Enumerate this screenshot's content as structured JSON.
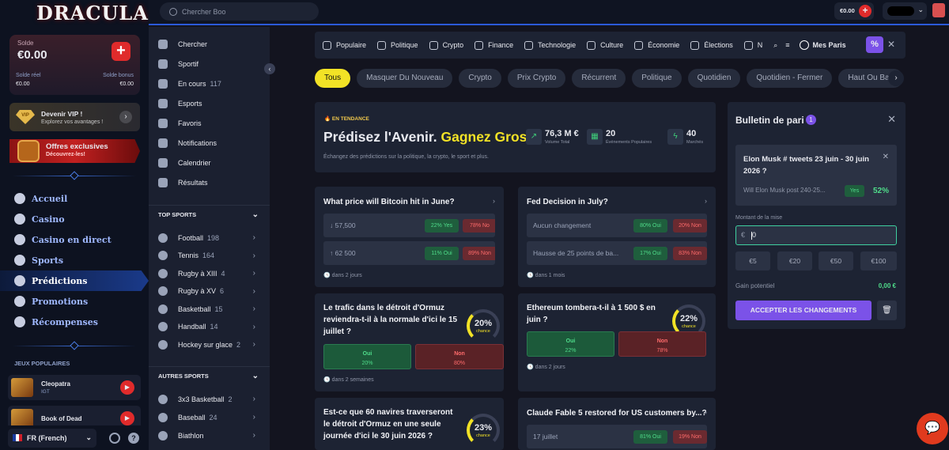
{
  "logo": "DRACULA",
  "wallet": {
    "label": "Solde",
    "amount": "€0.00",
    "real_label": "Solde réel",
    "real_value": "€0.00",
    "bonus_label": "Solde bonus",
    "bonus_value": "€0.00"
  },
  "vip": {
    "title": "Devenir VIP !",
    "subtitle": "Explorez vos avantages !",
    "gem": "VIP"
  },
  "offers": {
    "title": "Offres exclusives",
    "subtitle": "Découvrez-les!"
  },
  "menu": [
    {
      "label": "Accueil"
    },
    {
      "label": "Casino"
    },
    {
      "label": "Casino en direct"
    },
    {
      "label": "Sports"
    },
    {
      "label": "Prédictions"
    },
    {
      "label": "Promotions"
    },
    {
      "label": "Récompenses"
    }
  ],
  "popular_title": "JEUX POPULAIRES",
  "games": [
    {
      "name": "Cleopatra",
      "sub": "IGT"
    },
    {
      "name": "Book of Dead",
      "sub": ""
    }
  ],
  "language": "FR (French)",
  "search_placeholder": "Chercher Boo",
  "balance": "€0.00",
  "nav": {
    "items": [
      {
        "label": "Chercher",
        "count": ""
      },
      {
        "label": "Sportif",
        "count": ""
      },
      {
        "label": "En cours",
        "count": "117"
      },
      {
        "label": "Esports",
        "count": ""
      },
      {
        "label": "Favoris",
        "count": ""
      },
      {
        "label": "Notifications",
        "count": ""
      },
      {
        "label": "Calendrier",
        "count": ""
      },
      {
        "label": "Résultats",
        "count": ""
      }
    ],
    "top_sports_title": "TOP SPORTS",
    "top_sports": [
      {
        "label": "Football",
        "count": "198"
      },
      {
        "label": "Tennis",
        "count": "164"
      },
      {
        "label": "Rugby à XIII",
        "count": "4"
      },
      {
        "label": "Rugby à XV",
        "count": "6"
      },
      {
        "label": "Basketball",
        "count": "15"
      },
      {
        "label": "Handball",
        "count": "14"
      },
      {
        "label": "Hockey sur glace",
        "count": "2"
      }
    ],
    "other_sports_title": "AUTRES SPORTS",
    "other_sports": [
      {
        "label": "3x3 Basketball",
        "count": "2"
      },
      {
        "label": "Baseball",
        "count": "24"
      },
      {
        "label": "Biathlon",
        "count": ""
      }
    ]
  },
  "categories": [
    "Populaire",
    "Politique",
    "Crypto",
    "Finance",
    "Technologie",
    "Culture",
    "Économie",
    "Élections",
    "N"
  ],
  "my_bets": "Mes Paris",
  "chips": [
    "Tous",
    "Masquer Du Nouveau",
    "Crypto",
    "Prix Crypto",
    "Récurrent",
    "Politique",
    "Quotidien",
    "Quotidien - Fermer",
    "Haut Ou Bas",
    "B"
  ],
  "hero": {
    "trend": "EN TENDANCE",
    "title_a": "Prédisez l'Avenir.",
    "title_b": "Gagnez Gros.",
    "subtitle": "Échangez des prédictions sur la politique, la crypto, le sport et plus.",
    "stats": [
      {
        "value": "76,3 M €",
        "label": "Volume Total"
      },
      {
        "value": "20",
        "label": "Événements Populaires"
      },
      {
        "value": "40",
        "label": "Marchés"
      }
    ]
  },
  "cards": {
    "btc": {
      "q": "What price will Bitcoin hit in June?",
      "rows": [
        {
          "l": "↓ 57,500",
          "y": "22% Yes",
          "n": "78% No"
        },
        {
          "l": "↑ 62 500",
          "y": "11% Oui",
          "n": "89% Non"
        }
      ],
      "foot": "dans 2 jours"
    },
    "fed": {
      "q": "Fed Decision in July?",
      "rows": [
        {
          "l": "Aucun changement",
          "y": "80% Oui",
          "n": "20% Non"
        },
        {
          "l": "Hausse de 25 points de ba...",
          "y": "17% Oui",
          "n": "83% Non"
        }
      ],
      "foot": "dans 1 mois"
    },
    "ormuz": {
      "q": "Le trafic dans le détroit d'Ormuz reviendra-t-il à la normale d'ici le 15 juillet ?",
      "pct": "20%",
      "chance": "chance",
      "oui": "Oui",
      "oui_p": "20%",
      "non": "Non",
      "non_p": "80%",
      "foot": "dans 2 semaines"
    },
    "eth": {
      "q": "Ethereum tombera-t-il à 1 500 $ en juin ?",
      "pct": "22%",
      "chance": "chance",
      "oui": "Oui",
      "oui_p": "22%",
      "non": "Non",
      "non_p": "78%",
      "foot": "dans 2 jours"
    },
    "navires": {
      "q": "Est-ce que 60 navires traverseront le détroit d'Ormuz en une seule journée d'ici le 30 juin 2026 ?",
      "pct": "23%",
      "chance": "chance"
    },
    "claude": {
      "q": "Claude Fable 5 restored for US customers by...?",
      "row": {
        "l": "17 juillet",
        "y": "81% Oui",
        "n": "19% Non"
      }
    }
  },
  "slip": {
    "title": "Bulletin de pari",
    "count": "1",
    "sel_title": "Elon Musk # tweets 23 juin - 30 juin 2026 ?",
    "sel_desc": "Will Elon Musk post 240-25...",
    "sel_side": "Yes",
    "sel_pct": "52%",
    "stake_label": "Montant de la mise",
    "stake_currency": "€",
    "stake_value": "0",
    "quick": [
      "€5",
      "€20",
      "€50",
      "€100"
    ],
    "gain_label": "Gain potentiel",
    "gain_value": "0,00 €",
    "accept": "ACCEPTER LES CHANGEMENTS"
  }
}
